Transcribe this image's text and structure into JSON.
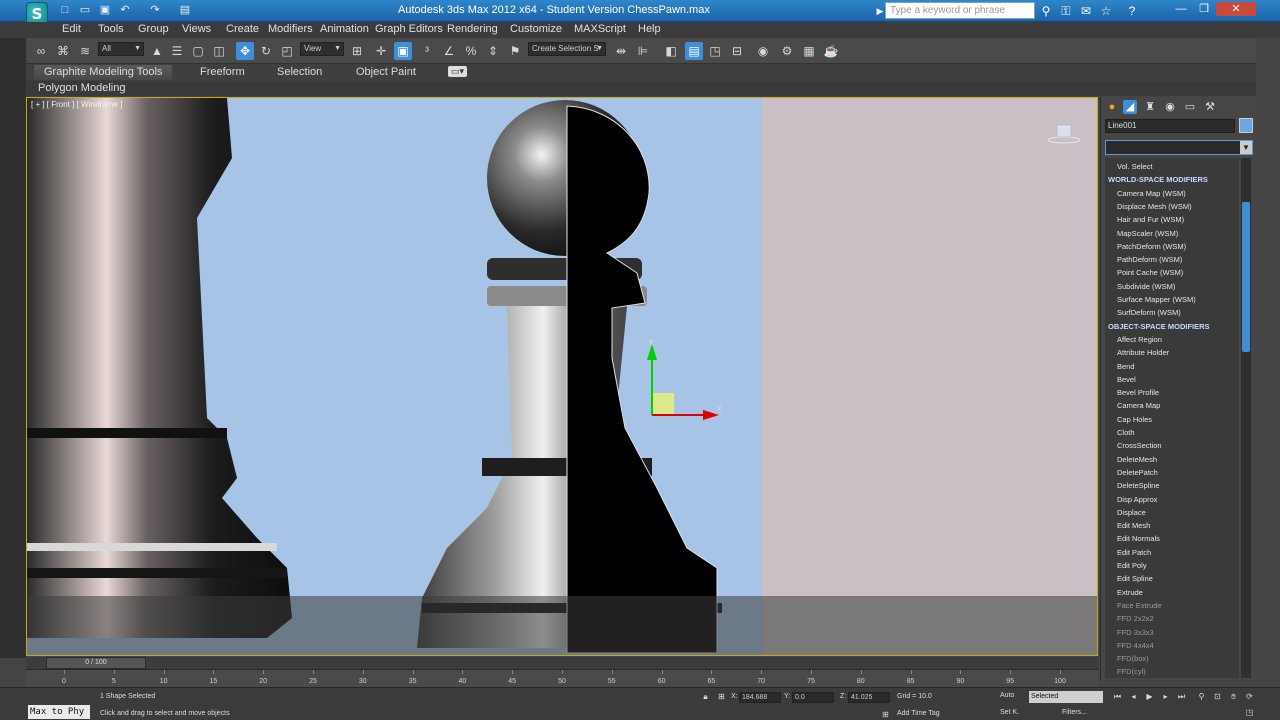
{
  "window": {
    "title": "Autodesk 3ds Max  2012 x64  - Student Version   ChessPawn.max",
    "help_search_placeholder": "Type a keyword or phrase",
    "logo_label": "S"
  },
  "menu": [
    "Edit",
    "Tools",
    "Group",
    "Views",
    "Create",
    "Modifiers",
    "Animation",
    "Graph Editors",
    "Rendering",
    "Customize",
    "MAXScript",
    "Help"
  ],
  "toolbar": {
    "selection_filter": "All",
    "reference_coord": "View",
    "named_selection": "Create Selection S"
  },
  "ribbon": {
    "tabs": [
      "Graphite Modeling Tools",
      "Freeform",
      "Selection",
      "Object Paint"
    ],
    "panel_label": "Polygon Modeling"
  },
  "viewport": {
    "label": "[ + ] [ Front ] [ Wireframe ]",
    "gizmo_axes": [
      "y",
      "x"
    ]
  },
  "command_panel": {
    "object_name": "Line001",
    "object_color": "#6aa6e0",
    "modifier_list": [
      {
        "label": "Vol. Select",
        "type": "item"
      },
      {
        "label": "WORLD-SPACE MODIFIERS",
        "type": "category"
      },
      {
        "label": "Camera Map (WSM)",
        "type": "item"
      },
      {
        "label": "Displace Mesh (WSM)",
        "type": "item"
      },
      {
        "label": "Hair and Fur (WSM)",
        "type": "item"
      },
      {
        "label": "MapScaler (WSM)",
        "type": "item"
      },
      {
        "label": "PatchDeform (WSM)",
        "type": "item"
      },
      {
        "label": "PathDeform (WSM)",
        "type": "item"
      },
      {
        "label": "Point Cache (WSM)",
        "type": "item"
      },
      {
        "label": "Subdivide (WSM)",
        "type": "item"
      },
      {
        "label": "Surface Mapper (WSM)",
        "type": "item"
      },
      {
        "label": "SurfDeform (WSM)",
        "type": "item"
      },
      {
        "label": "OBJECT-SPACE MODIFIERS",
        "type": "category"
      },
      {
        "label": "Affect Region",
        "type": "item"
      },
      {
        "label": "Attribute Holder",
        "type": "item"
      },
      {
        "label": "Bend",
        "type": "item"
      },
      {
        "label": "Bevel",
        "type": "item"
      },
      {
        "label": "Bevel Profile",
        "type": "item"
      },
      {
        "label": "Camera Map",
        "type": "item"
      },
      {
        "label": "Cap Holes",
        "type": "item"
      },
      {
        "label": "Cloth",
        "type": "item"
      },
      {
        "label": "CrossSection",
        "type": "item"
      },
      {
        "label": "DeleteMesh",
        "type": "item"
      },
      {
        "label": "DeletePatch",
        "type": "item"
      },
      {
        "label": "DeleteSpline",
        "type": "item"
      },
      {
        "label": "Disp Approx",
        "type": "item"
      },
      {
        "label": "Displace",
        "type": "item"
      },
      {
        "label": "Edit Mesh",
        "type": "item"
      },
      {
        "label": "Edit Normals",
        "type": "item"
      },
      {
        "label": "Edit Patch",
        "type": "item"
      },
      {
        "label": "Edit Poly",
        "type": "item"
      },
      {
        "label": "Edit Spline",
        "type": "item"
      },
      {
        "label": "Extrude",
        "type": "item"
      },
      {
        "label": "Face Extrude",
        "type": "dim"
      },
      {
        "label": "FFD 2x2x2",
        "type": "dim"
      },
      {
        "label": "FFD 3x3x3",
        "type": "dim"
      },
      {
        "label": "FFD 4x4x4",
        "type": "dim"
      },
      {
        "label": "FFD(box)",
        "type": "dim"
      },
      {
        "label": "FFD(cyl)",
        "type": "dim"
      }
    ]
  },
  "timeline": {
    "frame_readout": "0 / 100",
    "ticks": [
      0,
      5,
      10,
      15,
      20,
      25,
      30,
      35,
      40,
      45,
      50,
      55,
      60,
      65,
      70,
      75,
      80,
      85,
      90,
      95,
      100
    ]
  },
  "status": {
    "maxscript_label": "Max to Phy",
    "selection_text": "1 Shape Selected",
    "prompt_text": "Click and drag to select and move objects",
    "x_label": "X:",
    "x_value": "184.688",
    "y_label": "Y:",
    "y_value": "0.0",
    "z_label": "Z:",
    "z_value": "41.025",
    "grid_text": "Grid = 10.0",
    "add_time_tag": "Add Time Tag",
    "auto_key": "Auto",
    "set_key": "Set K.",
    "key_filter_value": "Selected",
    "filters_label": "Filters..."
  }
}
